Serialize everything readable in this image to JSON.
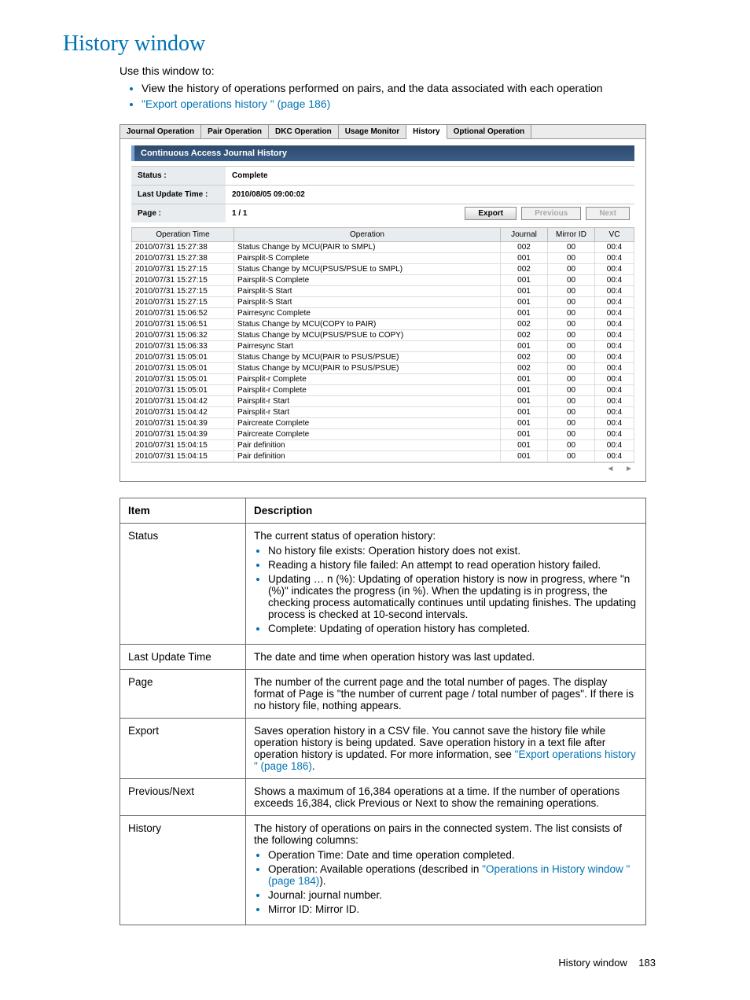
{
  "page_title": "History window",
  "intro": {
    "lead": "Use this window to:",
    "items": [
      {
        "text": "View the history of operations performed on pairs, and the data associated with each operation",
        "link": false
      },
      {
        "text": "\"Export operations history \" (page 186)",
        "link": true
      }
    ]
  },
  "tabs": [
    "Journal Operation",
    "Pair Operation",
    "DKC Operation",
    "Usage Monitor",
    "History",
    "Optional Operation"
  ],
  "active_tab": "History",
  "panel_title": "Continuous Access Journal History",
  "info": {
    "status_label": "Status :",
    "status_value": "Complete",
    "last_update_label": "Last Update Time :",
    "last_update_value": "2010/08/05 09:00:02",
    "page_label": "Page :",
    "page_value": "1 / 1",
    "export_btn": "Export",
    "prev_btn": "Previous",
    "next_btn": "Next"
  },
  "history_headers": [
    "Operation Time",
    "Operation",
    "Journal",
    "Mirror ID",
    "VC"
  ],
  "history_rows": [
    {
      "time": "2010/07/31 15:27:38",
      "op": "Status Change by MCU(PAIR to SMPL)",
      "j": "002",
      "m": "00",
      "vc": "00:4"
    },
    {
      "time": "2010/07/31 15:27:38",
      "op": "Pairsplit-S Complete",
      "j": "001",
      "m": "00",
      "vc": "00:4"
    },
    {
      "time": "2010/07/31 15:27:15",
      "op": "Status Change by MCU(PSUS/PSUE to SMPL)",
      "j": "002",
      "m": "00",
      "vc": "00:4"
    },
    {
      "time": "2010/07/31 15:27:15",
      "op": "Pairsplit-S Complete",
      "j": "001",
      "m": "00",
      "vc": "00:4"
    },
    {
      "time": "2010/07/31 15:27:15",
      "op": "Pairsplit-S Start",
      "j": "001",
      "m": "00",
      "vc": "00:4"
    },
    {
      "time": "2010/07/31 15:27:15",
      "op": "Pairsplit-S Start",
      "j": "001",
      "m": "00",
      "vc": "00:4"
    },
    {
      "time": "2010/07/31 15:06:52",
      "op": "Pairresync Complete",
      "j": "001",
      "m": "00",
      "vc": "00:4"
    },
    {
      "time": "2010/07/31 15:06:51",
      "op": "Status Change by MCU(COPY to PAIR)",
      "j": "002",
      "m": "00",
      "vc": "00:4"
    },
    {
      "time": "2010/07/31 15:06:32",
      "op": "Status Change by MCU(PSUS/PSUE to COPY)",
      "j": "002",
      "m": "00",
      "vc": "00:4"
    },
    {
      "time": "2010/07/31 15:06:33",
      "op": "Pairresync Start",
      "j": "001",
      "m": "00",
      "vc": "00:4"
    },
    {
      "time": "2010/07/31 15:05:01",
      "op": "Status Change by MCU(PAIR to PSUS/PSUE)",
      "j": "002",
      "m": "00",
      "vc": "00:4"
    },
    {
      "time": "2010/07/31 15:05:01",
      "op": "Status Change by MCU(PAIR to PSUS/PSUE)",
      "j": "002",
      "m": "00",
      "vc": "00:4"
    },
    {
      "time": "2010/07/31 15:05:01",
      "op": "Pairsplit-r Complete",
      "j": "001",
      "m": "00",
      "vc": "00:4"
    },
    {
      "time": "2010/07/31 15:05:01",
      "op": "Pairsplit-r Complete",
      "j": "001",
      "m": "00",
      "vc": "00:4"
    },
    {
      "time": "2010/07/31 15:04:42",
      "op": "Pairsplit-r Start",
      "j": "001",
      "m": "00",
      "vc": "00:4"
    },
    {
      "time": "2010/07/31 15:04:42",
      "op": "Pairsplit-r Start",
      "j": "001",
      "m": "00",
      "vc": "00:4"
    },
    {
      "time": "2010/07/31 15:04:39",
      "op": "Paircreate Complete",
      "j": "001",
      "m": "00",
      "vc": "00:4"
    },
    {
      "time": "2010/07/31 15:04:39",
      "op": "Paircreate Complete",
      "j": "001",
      "m": "00",
      "vc": "00:4"
    },
    {
      "time": "2010/07/31 15:04:15",
      "op": "Pair definition",
      "j": "001",
      "m": "00",
      "vc": "00:4"
    },
    {
      "time": "2010/07/31 15:04:15",
      "op": "Pair definition",
      "j": "001",
      "m": "00",
      "vc": "00:4"
    }
  ],
  "desc_headers": {
    "item": "Item",
    "desc": "Description"
  },
  "desc_rows": [
    {
      "item": "Status",
      "text": "The current status of operation history:",
      "bullets": [
        "No history file exists: Operation history does not exist.",
        "Reading a history file failed: An attempt to read operation history failed.",
        "Updating … n (%): Updating of operation history is now in progress, where \"n (%)\" indicates the progress (in %). When the updating is in progress, the checking process automatically continues until updating finishes. The updating process is checked at 10-second intervals.",
        "Complete: Updating of operation history has completed."
      ]
    },
    {
      "item": "Last Update Time",
      "text": "The date and time when operation history was last updated."
    },
    {
      "item": "Page",
      "text": "The number of the current page and the total number of pages. The display format of Page is \"the number of current page / total number of pages\". If there is no history file, nothing appears."
    },
    {
      "item": "Export",
      "html": "Saves operation history in a CSV file. You cannot save the history file while operation history is being updated. Save operation history in a text file after operation history is updated. For more information, see <span class='link'>\"Export operations history \" (page 186)</span>."
    },
    {
      "item": "Previous/Next",
      "text": "Shows a maximum of 16,384 operations at a time. If the number of operations exceeds 16,384, click Previous or Next to show the remaining operations."
    },
    {
      "item": "History",
      "text": "The history of operations on pairs in the connected system. The list consists of the following columns:",
      "bullets_html": [
        "Operation Time: Date and time operation completed.",
        "Operation: Available operations (described in <span class='link'>\"Operations in History window \" (page 184)</span>).",
        "Journal: journal number.",
        "Mirror ID: Mirror ID."
      ]
    }
  ],
  "footer": {
    "label": "History window",
    "page": "183"
  }
}
